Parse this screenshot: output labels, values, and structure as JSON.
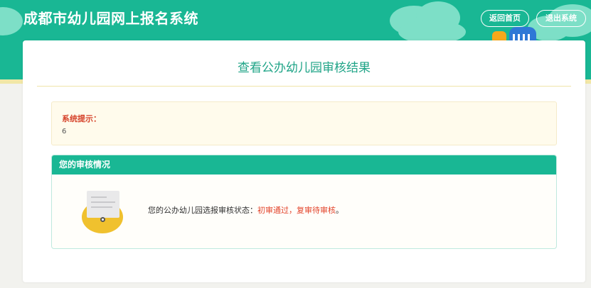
{
  "header": {
    "site_title": "成都市幼儿园网上报名系统",
    "home_button": "返回首页",
    "exit_button": "退出系统"
  },
  "main": {
    "page_title": "查看公办幼儿园审核结果",
    "notice": {
      "label": "系统提示：",
      "value": "6"
    },
    "review_panel": {
      "heading": "您的审核情况",
      "status_prefix": "您的公办幼儿园选报审核状态：",
      "status_value": "初审通过，复审待审核",
      "status_suffix": "。"
    }
  },
  "colors": {
    "brand_green": "#19b794",
    "title_green": "#1fa487",
    "warning_red": "#d6432b",
    "status_red": "#e3442b",
    "stripe_yellow": "#f1e7a6"
  },
  "icons": {
    "document": "document-icon",
    "building": "building-icon"
  }
}
